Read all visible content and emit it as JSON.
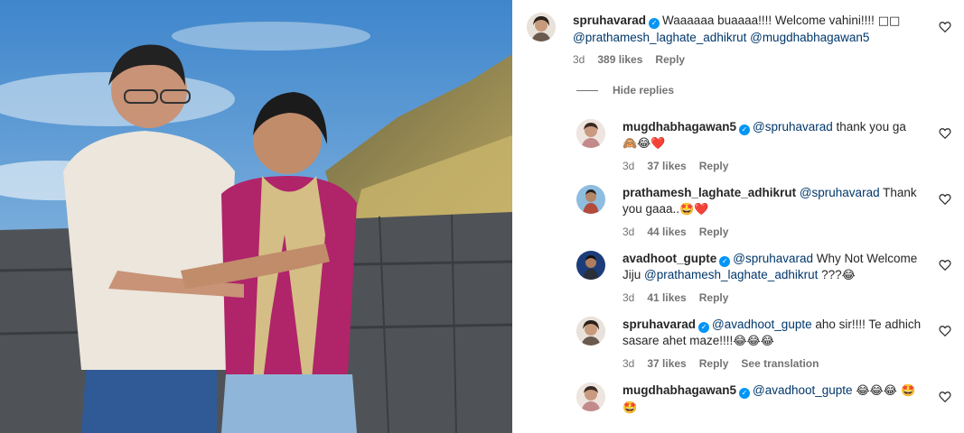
{
  "post_image": {
    "alt_subject": "couple-photo",
    "sky_color": "#5b9fd6",
    "wall_color": "#4e5256"
  },
  "comments": [
    {
      "username": "spruhavarad",
      "verified": true,
      "segments": [
        "Waaaaaa buaaaa!!!! Welcome vahini!!!! ",
        "@prathamesh_laghate_adhikrut",
        " ",
        "@mugdhabhagawan5"
      ],
      "emoji": "□□",
      "time": "3d",
      "likes": "389 likes",
      "reply_label": "Reply",
      "avatar_color": "#6b5a4e"
    }
  ],
  "hide_replies_label": "Hide replies",
  "replies": [
    {
      "username": "mugdhabhagawan5",
      "verified": true,
      "mention": "@spruhavarad",
      "text": " thank you ga",
      "emoji": "🙈😂❤️",
      "time": "3d",
      "likes": "37 likes",
      "reply_label": "Reply",
      "avatar_color": "#c28a8a"
    },
    {
      "username": "prathamesh_laghate_adhikrut",
      "verified": false,
      "mention": "@spruhavarad",
      "text": " Thank you gaaa..",
      "emoji": "🤩❤️",
      "time": "3d",
      "likes": "44 likes",
      "reply_label": "Reply",
      "avatar_color": "#b34a3c"
    },
    {
      "username": "avadhoot_gupte",
      "verified": true,
      "mention": "@spruhavarad",
      "text": " Why Not Welcome Jiju ",
      "mention2": "@prathamesh_laghate_adhikrut",
      "text2": " ???",
      "emoji": "😂",
      "time": "3d",
      "likes": "41 likes",
      "reply_label": "Reply",
      "avatar_color": "#1c3d7a"
    },
    {
      "username": "spruhavarad",
      "verified": true,
      "mention": "@avadhoot_gupte",
      "text": " aho sir!!!! Te adhich sasare ahet maze!!!!",
      "emoji": "😂😂😂",
      "time": "3d",
      "likes": "37 likes",
      "reply_label": "Reply",
      "translate_label": "See translation",
      "avatar_color": "#6b5a4e"
    },
    {
      "username": "mugdhabhagawan5",
      "verified": true,
      "mention": "@avadhoot_gupte",
      "text": " ",
      "emoji": "😂😂😂 🤩🤩",
      "avatar_color": "#c28a8a"
    }
  ],
  "icons": {
    "heart": "heart-outline-icon",
    "verified": "verified-badge-icon"
  }
}
